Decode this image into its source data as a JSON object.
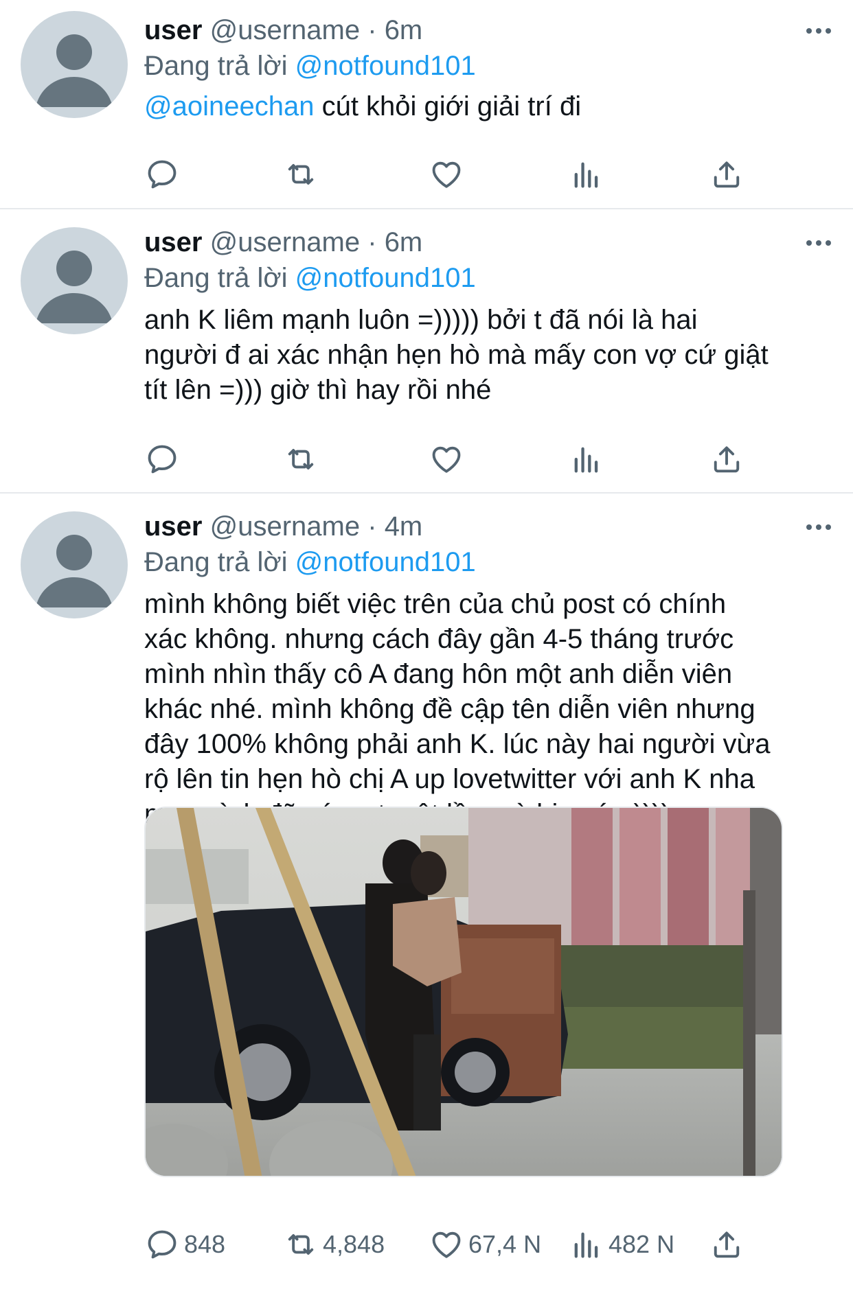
{
  "tweets": [
    {
      "name": "user",
      "handle": "@username",
      "dot": "·",
      "time": "6m",
      "reply_prefix": "Đang trả lời",
      "reply_to": "@notfound101",
      "body_mention": "@aoineechan",
      "body": " cút khỏi giới giải trí đi"
    },
    {
      "name": "user",
      "handle": "@username",
      "dot": "·",
      "time": "6m",
      "reply_prefix": "Đang trả lời",
      "reply_to": "@notfound101",
      "body_lines": [
        "anh K liêm mạnh luôn =))))) bởi t đã nói là hai",
        "người đ ai xác nhận hẹn hò mà mấy con vợ cứ giật",
        "tít lên =))) giờ thì hay rồi nhé"
      ]
    },
    {
      "name": "user",
      "handle": "@username",
      "dot": "·",
      "time": "4m",
      "reply_prefix": "Đang trả lời",
      "reply_to": "@notfound101",
      "body_lines": [
        "mình không biết việc trên của chủ post có chính",
        "xác không. nhưng cách đây gần 4-5 tháng trước",
        "mình nhìn thấy cô A đang hôn một anh diễn viên",
        "khác nhé. mình không đề cập tên diễn viên nhưng",
        "đây 100% không phải anh K. lúc này hai người vừa",
        "rộ lên tin hẹn hò chị A up lovetwitter với anh K nha",
        "mn. mình đã có cmt một lần mà bị xoá =))))"
      ],
      "counts": {
        "replies": "848",
        "retweets": "4,848",
        "likes": "67,4 N",
        "views": "482 N"
      }
    }
  ],
  "colors": {
    "accent": "#1d9bf0",
    "secondary_text": "#536471",
    "avatar_bg": "#ccd6dd",
    "avatar_fg": "#66757f"
  },
  "icons": [
    "reply-icon",
    "retweet-icon",
    "like-icon",
    "views-icon",
    "share-icon",
    "more-icon"
  ]
}
